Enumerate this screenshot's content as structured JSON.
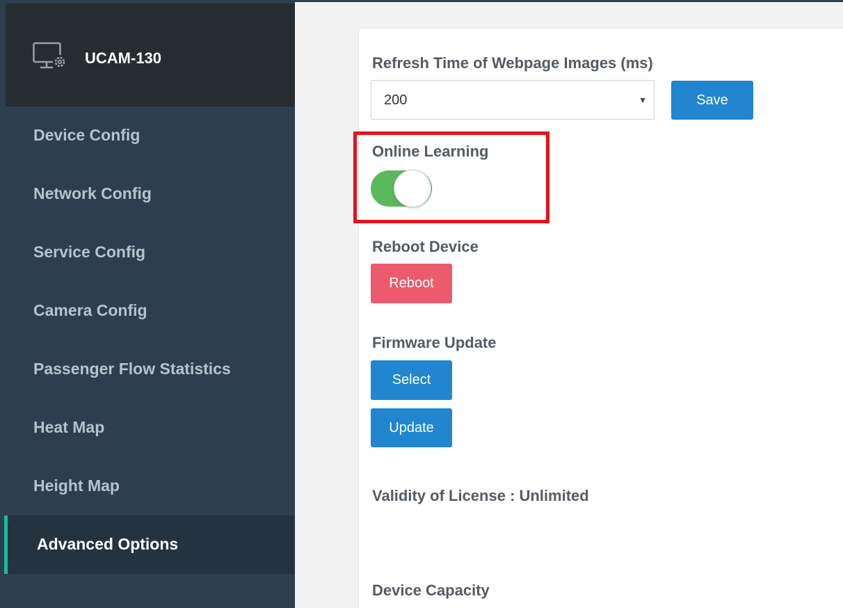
{
  "app": {
    "title": "UCAM-130",
    "icon": "monitor-gear-icon"
  },
  "sidebar": {
    "items": [
      {
        "label": "Device Config",
        "active": false
      },
      {
        "label": "Network Config",
        "active": false
      },
      {
        "label": "Service Config",
        "active": false
      },
      {
        "label": "Camera Config",
        "active": false
      },
      {
        "label": "Passenger Flow Statistics",
        "active": false
      },
      {
        "label": "Heat Map",
        "active": false
      },
      {
        "label": "Height Map",
        "active": false
      },
      {
        "label": "Advanced Options",
        "active": true
      }
    ]
  },
  "main": {
    "refresh": {
      "label": "Refresh Time of Webpage Images (ms)",
      "value": "200",
      "save_label": "Save"
    },
    "online_learning": {
      "label": "Online Learning",
      "enabled": true
    },
    "reboot": {
      "label": "Reboot Device",
      "button_label": "Reboot"
    },
    "firmware": {
      "label": "Firmware Update",
      "select_label": "Select",
      "update_label": "Update"
    },
    "license": {
      "text": "Validity of License : Unlimited"
    },
    "capacity": {
      "label": "Device Capacity"
    }
  },
  "colors": {
    "sidebar_bg": "#2e3e4e",
    "brand_bg": "#272c30",
    "active_accent": "#1abc9c",
    "primary_button": "#2185d0",
    "danger_button": "#ec5b6d",
    "toggle_on": "#5cb85c",
    "highlight_border": "#e3141d"
  }
}
